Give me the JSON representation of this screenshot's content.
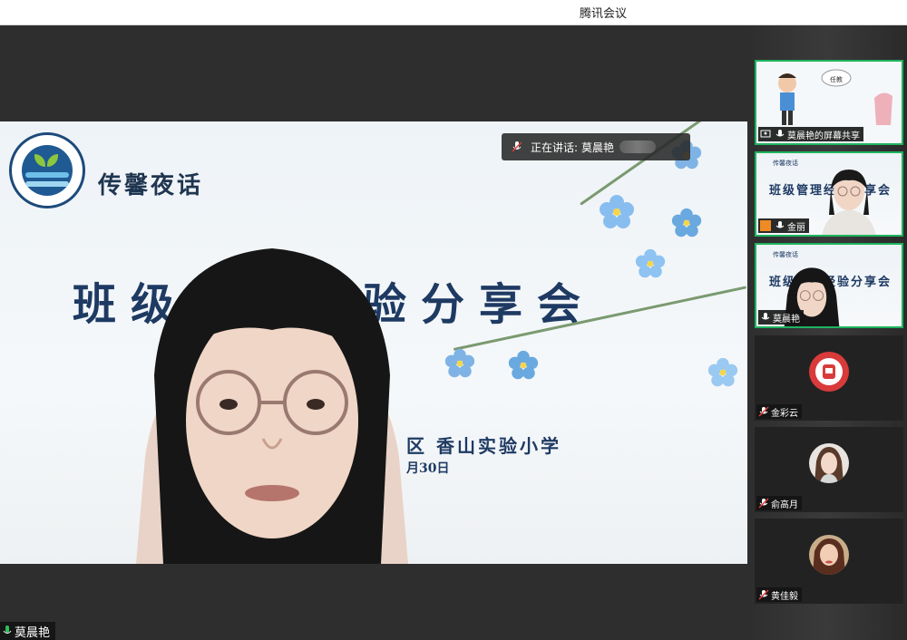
{
  "window": {
    "title": "腾讯会议"
  },
  "main": {
    "slide": {
      "tagline": "传馨夜话",
      "title": "班级管理经验分享会",
      "school": "区 香山实验小学",
      "date": "月30日"
    },
    "speaking": {
      "prefix": "正在讲话:",
      "name": "莫晨艳"
    },
    "speaker_name": "莫晨艳"
  },
  "sidebar": {
    "tiles": [
      {
        "name": "莫晨艳的屏幕共享",
        "kind": "screen-share",
        "active": true
      },
      {
        "name": "金丽",
        "kind": "video",
        "active": true
      },
      {
        "name": "莫晨艳",
        "kind": "video",
        "active": true
      },
      {
        "name": "金彩云",
        "kind": "avatar",
        "muted": true
      },
      {
        "name": "俞高月",
        "kind": "avatar",
        "muted": true
      },
      {
        "name": "黄佳毅",
        "kind": "avatar",
        "muted": true
      }
    ],
    "mini_slide": {
      "tag": "传馨夜话",
      "title": "班级管理经验分享会"
    },
    "cartoon_bubble": "任教"
  },
  "colors": {
    "active_border": "#1fb35f",
    "muted_mic": "#e03a3a",
    "slide_text": "#1e3a63"
  }
}
